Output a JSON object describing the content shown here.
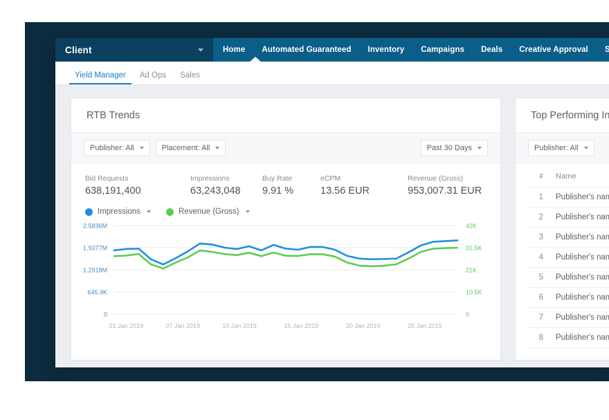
{
  "theme": {
    "backdrop": "#0d2b3e",
    "client_bar": "#0b415e",
    "nav_bar": "#0b5e88",
    "accent": "#1b7fc4",
    "impressions_color": "#1f8fe0",
    "revenue_color": "#5ecc52",
    "page_bg": "#eceef1"
  },
  "topnav": {
    "client_label": "Client",
    "client_caret_icon": "chevron-down-icon",
    "items": [
      {
        "label": "Home",
        "active": true
      },
      {
        "label": "Automated Guaranteed",
        "active": false
      },
      {
        "label": "Inventory",
        "active": false
      },
      {
        "label": "Campaigns",
        "active": false
      },
      {
        "label": "Deals",
        "active": false
      },
      {
        "label": "Creative Approval",
        "active": false
      },
      {
        "label": "Stats & Reports",
        "active": false
      }
    ]
  },
  "subnav": {
    "items": [
      {
        "label": "Yield Manager",
        "active": true
      },
      {
        "label": "Ad Ops",
        "active": false
      },
      {
        "label": "Sales",
        "active": false
      }
    ]
  },
  "left_card": {
    "title": "RTB Trends",
    "filters": [
      {
        "label": "Publisher: All",
        "caret_icon": "chevron-down-icon"
      },
      {
        "label": "Placement: All",
        "caret_icon": "chevron-down-icon"
      }
    ],
    "date_range": {
      "label": "Past 30 Days",
      "caret_icon": "chevron-down-icon"
    },
    "kpis": [
      {
        "label": "Bid Requests",
        "value": "638,191,400"
      },
      {
        "label": "Impressions",
        "value": "63,243,048"
      },
      {
        "label": "Buy Rate",
        "value": "9.91 %"
      },
      {
        "label": "eCPM",
        "value": "13.56 EUR"
      },
      {
        "label": "Revenue (Gross)",
        "value": "953,007.31 EUR"
      }
    ],
    "legend": [
      {
        "label": "Impressions",
        "color": "#1f8fe0",
        "caret_icon": "chevron-down-icon"
      },
      {
        "label": "Revenue (Gross)",
        "color": "#5ecc52",
        "caret_icon": "chevron-down-icon"
      }
    ]
  },
  "right_card": {
    "title": "Top Performing Inventory",
    "filter": {
      "label": "Publisher: All",
      "caret_icon": "chevron-down-icon"
    },
    "columns": [
      "#",
      "Name"
    ],
    "rows": [
      {
        "num": "1",
        "name": "Publisher's name"
      },
      {
        "num": "2",
        "name": "Publisher's name"
      },
      {
        "num": "3",
        "name": "Publisher's name"
      },
      {
        "num": "4",
        "name": "Publisher's name"
      },
      {
        "num": "5",
        "name": "Publisher's name"
      },
      {
        "num": "6",
        "name": "Publisher's name"
      },
      {
        "num": "7",
        "name": "Publisher's name"
      },
      {
        "num": "8",
        "name": "Publisher's name"
      }
    ]
  },
  "chart_data": {
    "type": "line",
    "title": "RTB Trends",
    "xlabel": "",
    "ylabel": "Impressions",
    "y2label": "Revenue (Gross)",
    "grid": true,
    "legend_position": "top-left",
    "x_tick_labels": [
      "01 Jan 2019",
      "07 Jan 2019",
      "10 Jan 2019",
      "15 Jan 2019",
      "20 Jan 2019",
      "25 Jan 2019"
    ],
    "y_left_ticks": [
      "0",
      "645.9K",
      "1.2918M",
      "1.9377M",
      "2.5836M"
    ],
    "y_left_values": [
      0,
      645900,
      1291800,
      1937700,
      2583600
    ],
    "ylim": [
      0,
      2583600
    ],
    "y_right_ticks": [
      "0",
      "10.5K",
      "21K",
      "31.5K",
      "42K"
    ],
    "y_right_values": [
      0,
      10500,
      21000,
      31500,
      42000
    ],
    "y2lim": [
      0,
      42000
    ],
    "series": [
      {
        "name": "Impressions",
        "color": "#1f8fe0",
        "axis": "left",
        "values": [
          1860000,
          1900000,
          1910000,
          1600000,
          1450000,
          1630000,
          1830000,
          2060000,
          2030000,
          1940000,
          1900000,
          1980000,
          1860000,
          2020000,
          1910000,
          1880000,
          1960000,
          1960000,
          1880000,
          1700000,
          1620000,
          1600000,
          1610000,
          1620000,
          1800000,
          2000000,
          2110000,
          2130000,
          2150000
        ]
      },
      {
        "name": "Revenue (Gross)",
        "color": "#5ecc52",
        "axis": "right",
        "values": [
          27500,
          27800,
          28500,
          23600,
          21600,
          24400,
          26900,
          30200,
          29500,
          28500,
          28000,
          29100,
          27500,
          29200,
          27700,
          27600,
          28400,
          28400,
          27300,
          24500,
          23000,
          22700,
          23000,
          23600,
          26300,
          29500,
          31000,
          31300,
          31500
        ]
      }
    ]
  }
}
